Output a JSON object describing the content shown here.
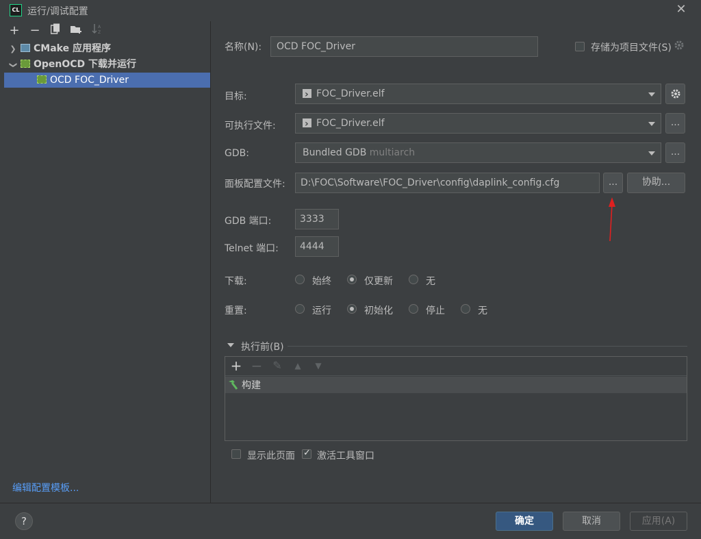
{
  "window": {
    "title": "运行/调试配置",
    "close_icon": "✕"
  },
  "left": {
    "tree": [
      {
        "label": "CMake 应用程序",
        "icon": "cmake-app-icon",
        "expanded": false
      },
      {
        "label": "OpenOCD 下载并运行",
        "icon": "openocd-chip-icon",
        "expanded": true
      },
      {
        "label": "OCD FOC_Driver",
        "icon": "openocd-chip-icon",
        "selected": true
      }
    ],
    "edit_templates": "编辑配置模板..."
  },
  "form": {
    "name_label": "名称(N):",
    "name_value": "OCD FOC_Driver",
    "store_as_project_file": "存储为项目文件(S)",
    "store_checked": false,
    "target_label": "目标:",
    "target_value": "FOC_Driver.elf",
    "executable_label": "可执行文件:",
    "executable_value": "FOC_Driver.elf",
    "gdb_label": "GDB:",
    "gdb_value": "Bundled GDB",
    "gdb_hint": "multiarch",
    "board_config_label": "面板配置文件:",
    "board_config_value": "D:\\FOC\\Software\\FOC_Driver\\config\\daplink_config.cfg",
    "browse": "...",
    "assist": "协助...",
    "gdb_port_label": "GDB 端口:",
    "gdb_port_value": "3333",
    "telnet_port_label": "Telnet 端口:",
    "telnet_port_value": "4444",
    "download_label": "下载:",
    "download_options": [
      "始终",
      "仅更新",
      "无"
    ],
    "download_selected": "仅更新",
    "reset_label": "重置:",
    "reset_options": [
      "运行",
      "初始化",
      "停止",
      "无"
    ],
    "reset_selected": "初始化",
    "before_launch_label": "执行前(B)",
    "before_launch_items": [
      "构建"
    ],
    "show_page_label": "显示此页面",
    "show_page_checked": false,
    "activate_tool_window_label": "激活工具窗口",
    "activate_tool_window_checked": true
  },
  "buttons": {
    "help": "?",
    "ok": "确定",
    "cancel": "取消",
    "apply": "应用(A)"
  },
  "colors": {
    "accent": "#365880",
    "selection": "#4b6eaf",
    "link": "#589df6",
    "annotation_arrow": "#e02020"
  }
}
